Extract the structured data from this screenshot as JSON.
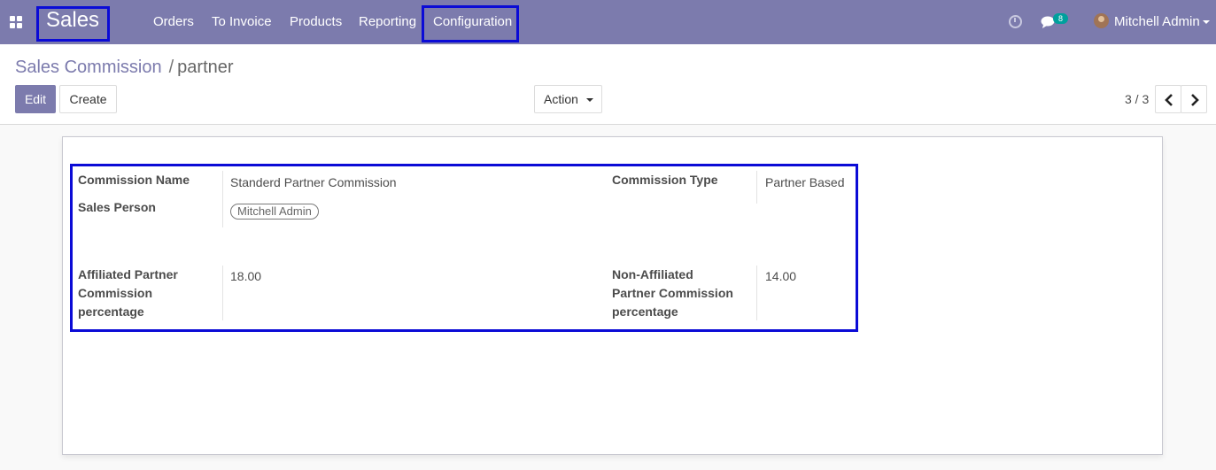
{
  "navbar": {
    "app_name": "Sales",
    "menu": [
      "Orders",
      "To Invoice",
      "Products",
      "Reporting",
      "Configuration"
    ],
    "messages_count": "8",
    "user_name": "Mitchell Admin",
    "background_color": "#7c7bad",
    "highlight_color": "#0b0bd6"
  },
  "breadcrumb": {
    "parent": "Sales Commission",
    "separator": "/",
    "current": "partner"
  },
  "toolbar": {
    "edit_label": "Edit",
    "create_label": "Create",
    "action_label": "Action"
  },
  "pager": {
    "value": "3 / 3"
  },
  "form": {
    "commission_name_label": "Commission Name",
    "commission_name_value": "Standerd Partner Commission",
    "sales_person_label": "Sales Person",
    "sales_person_tag": "Mitchell Admin",
    "commission_type_label": "Commission Type",
    "commission_type_value": "Partner Based",
    "affiliated_label_line1": "Affiliated Partner",
    "affiliated_label_line2": "Commission",
    "affiliated_label_line3": "percentage",
    "affiliated_value": "18.00",
    "non_affiliated_label_line1": "Non-Affiliated",
    "non_affiliated_label_line2": "Partner Commission",
    "non_affiliated_label_line3": "percentage",
    "non_affiliated_value": "14.00"
  }
}
